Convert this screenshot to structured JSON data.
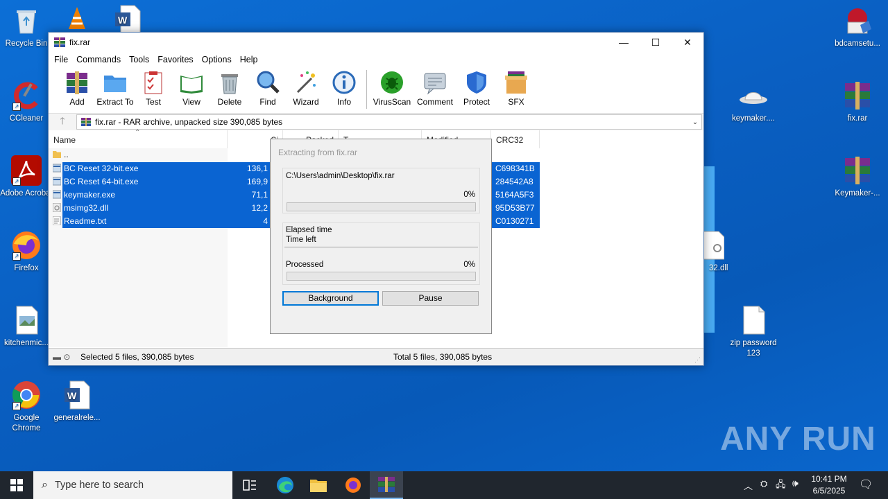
{
  "desktop": {
    "icons": [
      {
        "label": "Recycle Bin",
        "icon": "recycle-bin-icon"
      },
      {
        "label": "CCleaner",
        "icon": "ccleaner-icon"
      },
      {
        "label": "Adobe Acrobat",
        "icon": "adobe-acrobat-icon"
      },
      {
        "label": "Firefox",
        "icon": "firefox-icon"
      },
      {
        "label": "kitchenmic...",
        "icon": "image-file-icon"
      },
      {
        "label": "Google Chrome",
        "icon": "chrome-icon"
      },
      {
        "label": "generalrele...",
        "icon": "word-doc-icon"
      },
      {
        "label": "bdcamsetu...",
        "icon": "bandicam-setup-icon"
      },
      {
        "label": "keymaker....",
        "icon": "keymaker-icon"
      },
      {
        "label": "fix.rar",
        "icon": "winrar-archive-icon"
      },
      {
        "label": "Keymaker-...",
        "icon": "winrar-archive-icon"
      },
      {
        "label": "zip password 123",
        "icon": "text-file-icon"
      },
      {
        "label": "32.dll",
        "icon": "dll-file-icon"
      }
    ],
    "watermark": "ANY RUN"
  },
  "window": {
    "title": "fix.rar",
    "menu": [
      "File",
      "Commands",
      "Tools",
      "Favorites",
      "Options",
      "Help"
    ],
    "toolbar": [
      "Add",
      "Extract To",
      "Test",
      "View",
      "Delete",
      "Find",
      "Wizard",
      "Info",
      "VirusScan",
      "Comment",
      "Protect",
      "SFX"
    ],
    "address": "fix.rar - RAR archive, unpacked size 390,085 bytes",
    "columns": {
      "name": "Name",
      "size": "Si",
      "packed": "Packed",
      "type": "T",
      "modified": "Modified",
      "crc": "CRC32"
    },
    "parent_row": "..",
    "files": [
      {
        "name": "BC Reset 32-bit.exe",
        "size": "136,1",
        "crc": "C698341B",
        "kind": "exe"
      },
      {
        "name": "BC Reset 64-bit.exe",
        "size": "169,9",
        "crc": "284542A8",
        "kind": "exe"
      },
      {
        "name": "keymaker.exe",
        "size": "71,1",
        "crc": "5164A5F3",
        "kind": "exe"
      },
      {
        "name": "msimg32.dll",
        "size": "12,2",
        "crc": "95D53B77",
        "kind": "dll"
      },
      {
        "name": "Readme.txt",
        "size": "4",
        "crc": "C0130271",
        "kind": "txt"
      }
    ],
    "status_left": "Selected 5 files, 390,085 bytes",
    "status_right": "Total 5 files, 390,085 bytes"
  },
  "dialog": {
    "title": "Extracting from fix.rar",
    "path": "C:\\Users\\admin\\Desktop\\fix.rar",
    "file_percent": "0%",
    "file_progress": 0,
    "elapsed_label": "Elapsed time",
    "time_left_label": "Time left",
    "processed_label": "Processed",
    "processed_percent": "0%",
    "processed_progress": 0,
    "background_button": "Background",
    "pause_button": "Pause"
  },
  "taskbar": {
    "search_placeholder": "Type here to search",
    "time": "10:41 PM",
    "date": "6/5/2025"
  }
}
